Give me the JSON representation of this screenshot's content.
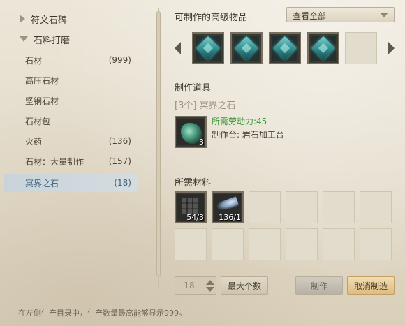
{
  "tree": {
    "categories": [
      {
        "label": "符文石碑",
        "expanded": false
      },
      {
        "label": "石料打磨",
        "expanded": true
      }
    ],
    "items": [
      {
        "name": "石材",
        "count": "(999)"
      },
      {
        "name": "高压石材",
        "count": ""
      },
      {
        "name": "坚钢石材",
        "count": ""
      },
      {
        "name": "石材包",
        "count": ""
      },
      {
        "name": "火药",
        "count": "(136)"
      },
      {
        "name": "石材：大量制作",
        "count": "(157)"
      },
      {
        "name": "冥界之石",
        "count": "(18)"
      }
    ],
    "selected_index": 6
  },
  "advanced": {
    "title": "可制作的高级物品",
    "filter_value": "查看全部"
  },
  "tool": {
    "section_title": "制作道具",
    "quantity_line": "[3个] 冥界之石",
    "labor_cost": "所需劳动力:45",
    "station": "制作台: 岩石加工台",
    "icon_count": "3"
  },
  "materials": {
    "section_title": "所需材料",
    "items": [
      {
        "icon": "stone-block-icon",
        "count": "54/3"
      },
      {
        "icon": "gunpowder-icon",
        "count": "136/1"
      }
    ]
  },
  "controls": {
    "quantity": "18",
    "max_label": "最大个数",
    "craft_label": "制作",
    "cancel_label": "取消制造"
  },
  "footer_note": "在左侧生产目录中，生产数量最高能够显示999。"
}
